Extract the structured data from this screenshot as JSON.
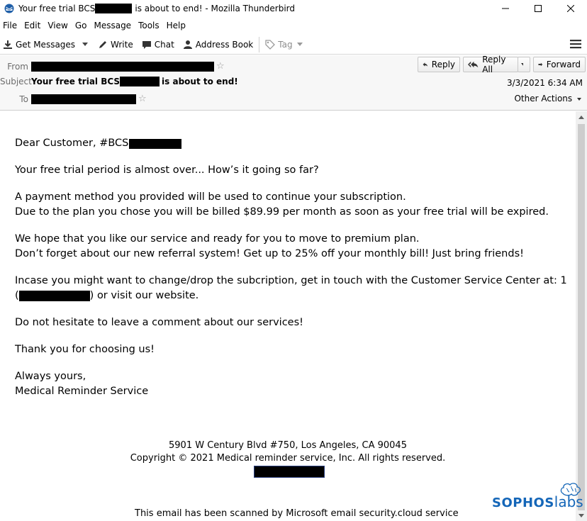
{
  "window": {
    "title_prefix": "Your free trial BCS",
    "title_suffix": "is about to end! - Mozilla Thunderbird"
  },
  "menu": [
    "File",
    "Edit",
    "View",
    "Go",
    "Message",
    "Tools",
    "Help"
  ],
  "toolbar": {
    "get_messages": "Get Messages",
    "write": "Write",
    "chat": "Chat",
    "address_book": "Address Book",
    "tag": "Tag"
  },
  "header": {
    "from_label": "From",
    "subject_label": "Subject",
    "to_label": "To",
    "subject_prefix": "Your free trial BCS",
    "subject_suffix": "is about to end!",
    "date": "3/3/2021 6:34 AM",
    "reply": "Reply",
    "reply_all": "Reply All",
    "forward": "Forward",
    "other_actions": "Other Actions"
  },
  "body": {
    "greeting": "Dear Customer, #BCS",
    "p1": "Your free trial period is almost over... How’s it going so far?",
    "p2a": "A payment method you provided will be used to continue your subscription.",
    "p2b": "Due to the plan you chose you will be billed $89.99 per month as soon as your free trial will be expired.",
    "p3a": "We hope that you like our service and ready for you to move to premium plan.",
    "p3b": "Don’t forget about our new referral system! Get up to 25% off your monthly bill! Just bring friends!",
    "p4a": "Incase you might want to change/drop the subcription, get in touch with the Customer Service Center at: 1",
    "p4b_open": "(",
    "p4b_close": ") or visit our website.",
    "p5": "Do not hesitate to leave a comment about our services!",
    "p6": "Thank you for choosing us!",
    "sign1": "Always yours,",
    "sign2": "Medical Reminder Service",
    "address": "5901 W Century Blvd #750, Los Angeles, CA 90045",
    "copyright": "Copyright © 2021 Medical reminder service, Inc. All rights reserved.",
    "scan_notice": "This email has been scanned by Microsoft email security.cloud service"
  },
  "logo": {
    "part1": "SOPHOS",
    "part2": "labs",
    "color": "#1466b8"
  }
}
